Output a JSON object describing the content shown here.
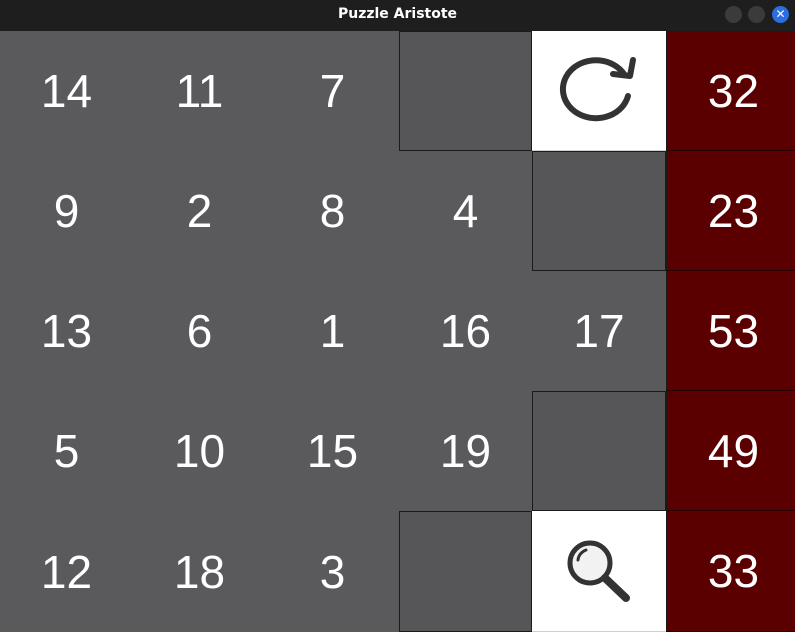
{
  "window": {
    "title": "Puzzle Aristote"
  },
  "board": {
    "rows": [
      [
        "14",
        "11",
        "7",
        "",
        "",
        "32"
      ],
      [
        "9",
        "2",
        "8",
        "4",
        "",
        "23"
      ],
      [
        "13",
        "6",
        "1",
        "16",
        "17",
        "53"
      ],
      [
        "5",
        "10",
        "15",
        "19",
        "",
        "49"
      ],
      [
        "12",
        "18",
        "3",
        "",
        "",
        "33"
      ]
    ]
  },
  "icons": {
    "reset": "refresh-icon",
    "check": "magnifier-icon"
  },
  "colors": {
    "board_bg": "#5a5a5c",
    "empty_bg": "#565658",
    "sum_bg": "#5a0000",
    "button_bg": "#ffffff",
    "text": "#ffffff"
  }
}
